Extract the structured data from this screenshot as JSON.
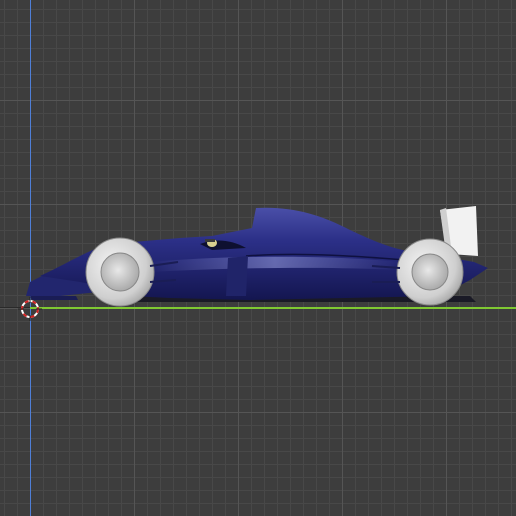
{
  "viewport": {
    "view": "side-orthographic",
    "grid": true,
    "background_color": "#3d3d3d",
    "grid_color": "#555555",
    "axis_colors": {
      "z": "#4f7fd8",
      "y": "#7fc832"
    }
  },
  "model": {
    "object": "formula-car",
    "body_color": "#2b2f7a",
    "wing_color": "#f2f2f2",
    "tire_color": "#d8d8d8"
  },
  "cursor": {
    "icon": "3d-cursor-icon",
    "color": "#d22222"
  }
}
